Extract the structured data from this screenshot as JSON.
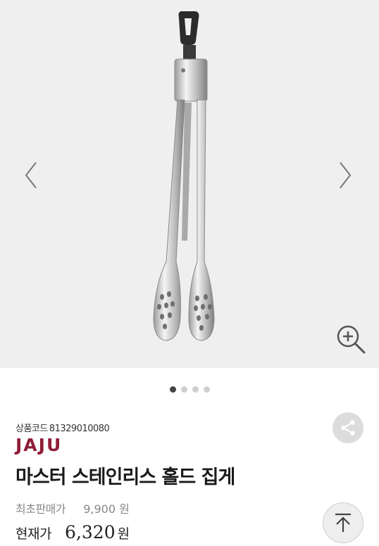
{
  "gallery": {
    "prev_icon": "chevron-left-icon",
    "next_icon": "chevron-right-icon",
    "zoom_icon": "zoom-in-icon",
    "slide_count": 4,
    "active_slide": 1
  },
  "product": {
    "code_label": "상품코드",
    "code_value": "81329010080",
    "brand": "JAJU",
    "title": "마스터 스테인리스 홀드 집게",
    "original_price_label": "최초판매가",
    "original_price": "9,900 원",
    "current_price_label": "현재가",
    "current_price": "6,320",
    "currency": "원"
  },
  "actions": {
    "share_icon": "share-icon",
    "scroll_top_icon": "arrow-up-to-top-icon"
  },
  "colors": {
    "brand": "#8f1d36",
    "image_background": "#efefef",
    "active_dot": "#444444",
    "inactive_dot": "#cfcfcf"
  }
}
